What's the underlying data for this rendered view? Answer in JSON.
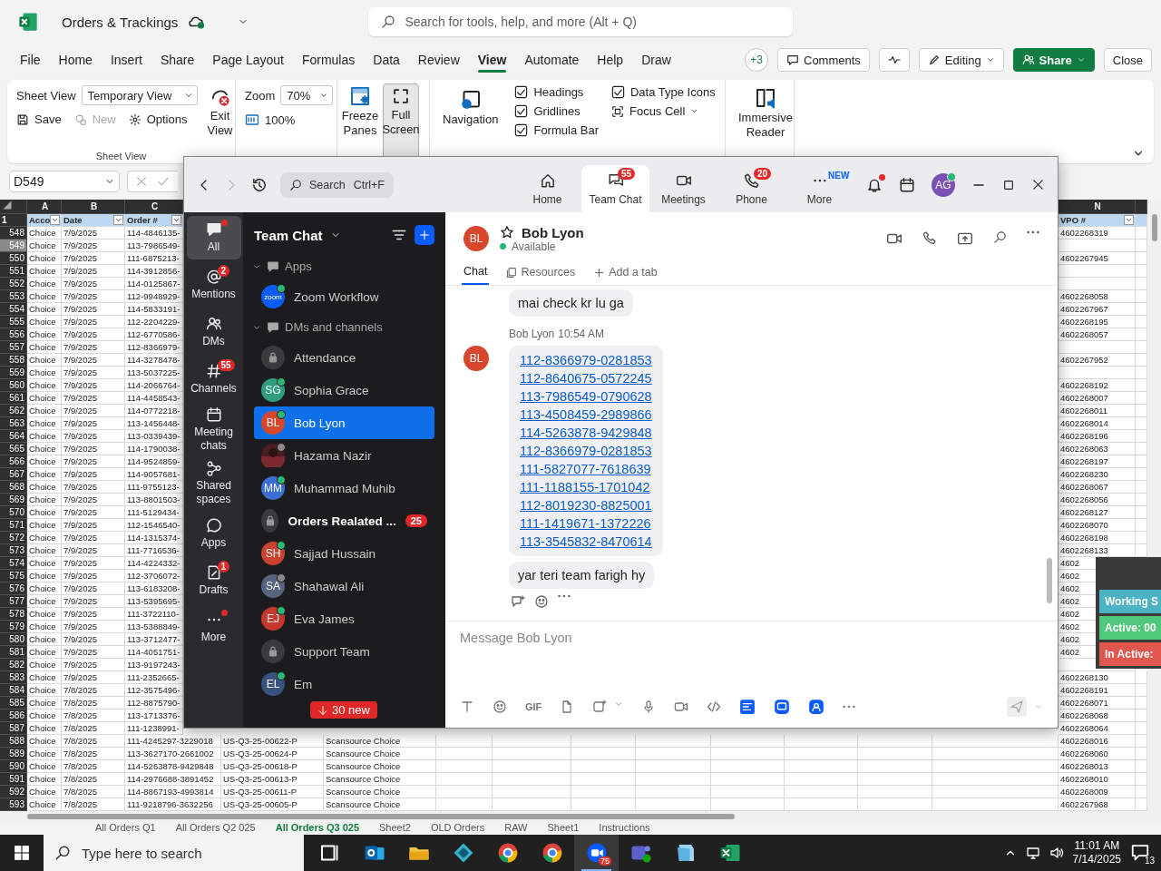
{
  "excel": {
    "title": "Orders & Trackings",
    "search_placeholder": "Search for tools, help, and more (Alt + Q)",
    "menu": [
      {
        "label": "File",
        "selected": false
      },
      {
        "label": "Home",
        "selected": false
      },
      {
        "label": "Insert",
        "selected": false
      },
      {
        "label": "Share",
        "selected": false
      },
      {
        "label": "Page Layout",
        "selected": false
      },
      {
        "label": "Formulas",
        "selected": false
      },
      {
        "label": "Data",
        "selected": false
      },
      {
        "label": "Review",
        "selected": false
      },
      {
        "label": "View",
        "selected": true
      },
      {
        "label": "Automate",
        "selected": false
      },
      {
        "label": "Help",
        "selected": false
      },
      {
        "label": "Draw",
        "selected": false
      }
    ],
    "more_count": "+3",
    "actions": [
      {
        "kind": "comments",
        "label": "Comments"
      },
      {
        "kind": "activity"
      },
      {
        "kind": "editing",
        "label": "Editing"
      },
      {
        "kind": "share",
        "label": "Share"
      },
      {
        "kind": "close",
        "label": "Close"
      }
    ],
    "ribbon": {
      "sheet_view": {
        "label": "Sheet View",
        "value": "Temporary View",
        "exit": "Exit View",
        "save": "Save",
        "new": {
          "label": "New",
          "disabled": true
        },
        "options": "Options",
        "group": "Sheet View"
      },
      "zoom": {
        "label": "Zoom",
        "value": "70%",
        "reset": "100%"
      },
      "window": {
        "freeze": "Freeze Panes",
        "full": {
          "label": "Full Screen",
          "selected": true
        }
      },
      "show": {
        "navigation": "Navigation",
        "checks": [
          {
            "label": "Headings",
            "checked": true
          },
          {
            "label": "Gridlines",
            "checked": true
          },
          {
            "label": "Formula Bar",
            "checked": true
          },
          {
            "label": "Data Type Icons",
            "checked": true
          }
        ],
        "focus": "Focus Cell"
      },
      "views": {
        "reader": "Immersive Reader"
      }
    },
    "name_box": "D549",
    "columns": [
      {
        "letter": "A",
        "heading": "Acco"
      },
      {
        "letter": "B",
        "heading": "Date"
      },
      {
        "letter": "C",
        "heading": "Order #"
      },
      {
        "letter": "N",
        "heading": "VPO #"
      }
    ],
    "header_row": "1",
    "rows": [
      {
        "number": "548",
        "selected": false,
        "account": "Choice",
        "date": "7/9/2025",
        "order": "114-4846135-",
        "vpo": "4602268319"
      },
      {
        "number": "549",
        "selected": true,
        "account": "Choice",
        "date": "7/9/2025",
        "order": "113-7986549-"
      },
      {
        "number": "550",
        "selected": false,
        "account": "Choice",
        "date": "7/9/2025",
        "order": "111-6875213-",
        "vpo": "4602267945"
      },
      {
        "number": "551",
        "selected": false,
        "account": "Choice",
        "date": "7/9/2025",
        "order": "114-3912856-"
      },
      {
        "number": "552",
        "selected": false,
        "account": "Choice",
        "date": "7/9/2025",
        "order": "114-0125867-"
      },
      {
        "number": "553",
        "selected": false,
        "account": "Choice",
        "date": "7/9/2025",
        "order": "112-9948929-",
        "vpo": "4602268058"
      },
      {
        "number": "554",
        "selected": false,
        "account": "Choice",
        "date": "7/9/2025",
        "order": "114-5833191-",
        "vpo": "4602267967"
      },
      {
        "number": "555",
        "selected": false,
        "account": "Choice",
        "date": "7/9/2025",
        "order": "112-2204229-",
        "vpo": "4602268195"
      },
      {
        "number": "556",
        "selected": false,
        "account": "Choice",
        "date": "7/9/2025",
        "order": "112-6770586-",
        "vpo": "4602268057"
      },
      {
        "number": "557",
        "selected": false,
        "account": "Choice",
        "date": "7/9/2025",
        "order": "112-8366979-"
      },
      {
        "number": "558",
        "selected": false,
        "account": "Choice",
        "date": "7/9/2025",
        "order": "114-3278478-",
        "vpo": "4602267952"
      },
      {
        "number": "559",
        "selected": false,
        "account": "Choice",
        "date": "7/9/2025",
        "order": "113-5037225-"
      },
      {
        "number": "560",
        "selected": false,
        "account": "Choice",
        "date": "7/9/2025",
        "order": "114-2066764-",
        "vpo": "4602268192"
      },
      {
        "number": "561",
        "selected": false,
        "account": "Choice",
        "date": "7/9/2025",
        "order": "114-4458543-",
        "vpo": "4602268007"
      },
      {
        "number": "562",
        "selected": false,
        "account": "Choice",
        "date": "7/9/2025",
        "order": "114-0772218-",
        "vpo": "4602268011"
      },
      {
        "number": "563",
        "selected": false,
        "account": "Choice",
        "date": "7/9/2025",
        "order": "113-1456448-",
        "vpo": "4602268014"
      },
      {
        "number": "564",
        "selected": false,
        "account": "Choice",
        "date": "7/9/2025",
        "order": "113-0339439-",
        "vpo": "4602268196"
      },
      {
        "number": "565",
        "selected": false,
        "account": "Choice",
        "date": "7/9/2025",
        "order": "114-1790038-",
        "vpo": "4602268063"
      },
      {
        "number": "566",
        "selected": false,
        "account": "Choice",
        "date": "7/9/2025",
        "order": "114-9524859-",
        "vpo": "4602268197"
      },
      {
        "number": "567",
        "selected": false,
        "account": "Choice",
        "date": "7/9/2025",
        "order": "114-9057681-",
        "vpo": "4602268230"
      },
      {
        "number": "568",
        "selected": false,
        "account": "Choice",
        "date": "7/9/2025",
        "order": "111-9755123-",
        "vpo": "4602268067"
      },
      {
        "number": "569",
        "selected": false,
        "account": "Choice",
        "date": "7/9/2025",
        "order": "113-8801503-",
        "vpo": "4602268056"
      },
      {
        "number": "570",
        "selected": false,
        "account": "Choice",
        "date": "7/9/2025",
        "order": "111-5129434-",
        "vpo": "4602268127"
      },
      {
        "number": "571",
        "selected": false,
        "account": "Choice",
        "date": "7/9/2025",
        "order": "112-1546540-",
        "vpo": "4602268070"
      },
      {
        "number": "572",
        "selected": false,
        "account": "Choice",
        "date": "7/9/2025",
        "order": "114-1315374-",
        "vpo": "4602268198"
      },
      {
        "number": "573",
        "selected": false,
        "account": "Choice",
        "date": "7/9/2025",
        "order": "111-7716536-",
        "vpo": "4602268133"
      },
      {
        "number": "574",
        "selected": false,
        "account": "Choice",
        "date": "7/9/2025",
        "order": "114-4224332-",
        "vpo": "4602"
      },
      {
        "number": "575",
        "selected": false,
        "account": "Choice",
        "date": "7/9/2025",
        "order": "112-3706072-",
        "vpo": "4602"
      },
      {
        "number": "576",
        "selected": false,
        "account": "Choice",
        "date": "7/9/2025",
        "order": "113-6183208-",
        "vpo": "4602"
      },
      {
        "number": "577",
        "selected": false,
        "account": "Choice",
        "date": "7/9/2025",
        "order": "113-5395695-",
        "vpo": "4602"
      },
      {
        "number": "578",
        "selected": false,
        "account": "Choice",
        "date": "7/9/2025",
        "order": "111-3722110-",
        "vpo": "4602"
      },
      {
        "number": "579",
        "selected": false,
        "account": "Choice",
        "date": "7/9/2025",
        "order": "113-5388849-",
        "vpo": "4602"
      },
      {
        "number": "580",
        "selected": false,
        "account": "Choice",
        "date": "7/9/2025",
        "order": "113-3712477-",
        "vpo": "4602"
      },
      {
        "number": "581",
        "selected": false,
        "account": "Choice",
        "date": "7/9/2025",
        "order": "114-4051751-",
        "vpo": "4602"
      },
      {
        "number": "582",
        "selected": false,
        "account": "Choice",
        "date": "7/9/2025",
        "order": "113-9197243-"
      },
      {
        "number": "583",
        "selected": false,
        "account": "Choice",
        "date": "7/9/2025",
        "order": "111-2352665-",
        "vpo": "4602268130"
      },
      {
        "number": "584",
        "selected": false,
        "account": "Choice",
        "date": "7/8/2025",
        "order": "112-3575496-",
        "vpo": "4602268191"
      },
      {
        "number": "585",
        "selected": false,
        "account": "Choice",
        "date": "7/8/2025",
        "order": "112-8875790-",
        "vpo": "4602268071"
      },
      {
        "number": "586",
        "selected": false,
        "account": "Choice",
        "date": "7/8/2025",
        "order": "113-1713376-",
        "vpo": "4602268068"
      },
      {
        "number": "587",
        "selected": false,
        "account": "Choice",
        "date": "7/8/2025",
        "order": "111-1238991-",
        "vpo": "4602268064"
      },
      {
        "number": "588",
        "selected": false,
        "account": "Choice",
        "date": "7/8/2025",
        "order": "111-4245297-3229018",
        "po": "US-Q3-25-00622-P",
        "vendor": "Scansource Choice",
        "vpo": "4602268016"
      },
      {
        "number": "589",
        "selected": false,
        "account": "Choice",
        "date": "7/8/2025",
        "order": "113-3627170-2661002",
        "po": "US-Q3-25-00624-P",
        "vendor": "Scansource Choice",
        "vpo": "4602268060"
      },
      {
        "number": "590",
        "selected": false,
        "account": "Choice",
        "date": "7/8/2025",
        "order": "114-5263878-9429848",
        "po": "US-Q3-25-00618-P",
        "vendor": "Scansource Choice",
        "vpo": "4602268013"
      },
      {
        "number": "591",
        "selected": false,
        "account": "Choice",
        "date": "7/8/2025",
        "order": "114-2976688-3891452",
        "po": "US-Q3-25-00613-P",
        "vendor": "Scansource Choice",
        "vpo": "4602268010"
      },
      {
        "number": "592",
        "selected": false,
        "account": "Choice",
        "date": "7/8/2025",
        "order": "114-8867193-4993814",
        "po": "US-Q3-25-00611-P",
        "vendor": "Scansource Choice",
        "vpo": "4602268009"
      },
      {
        "number": "593",
        "selected": false,
        "account": "Choice",
        "date": "7/8/2025",
        "order": "111-9218796-3632256",
        "po": "US-Q3-25-00605-P",
        "vendor": "Scansource Choice",
        "vpo": "4602267968"
      }
    ],
    "sheet_tabs": [
      {
        "label": "All Orders Q1",
        "selected": false
      },
      {
        "label": "All Orders Q2 025",
        "selected": false
      },
      {
        "label": "All Orders Q3 025",
        "selected": true
      },
      {
        "label": "Sheet2",
        "selected": false
      },
      {
        "label": "OLD Orders",
        "selected": false
      },
      {
        "label": "RAW",
        "selected": false
      },
      {
        "label": "Sheet1",
        "selected": false
      },
      {
        "label": "Instructions",
        "selected": false
      }
    ]
  },
  "zoom": {
    "nav": {
      "forward_disabled": true
    },
    "search": {
      "placeholder": "Search",
      "shortcut": "Ctrl+F"
    },
    "tabs": [
      {
        "kind": "home",
        "label": "Home",
        "selected": false
      },
      {
        "kind": "chat",
        "label": "Team Chat",
        "selected": true,
        "badge": "55"
      },
      {
        "kind": "meetings",
        "label": "Meetings",
        "selected": false
      },
      {
        "kind": "phone",
        "label": "Phone",
        "selected": false,
        "badge": "20"
      },
      {
        "kind": "more",
        "label": "More",
        "selected": false,
        "tag": "NEW"
      }
    ],
    "notification_dot": true,
    "avatar": "AG",
    "rail": [
      {
        "kind": "all",
        "label": "All",
        "selected": true,
        "dot": true
      },
      {
        "kind": "mentions",
        "label": "Mentions",
        "selected": false,
        "badge": "2",
        "dot": false
      },
      {
        "kind": "dms",
        "label": "DMs",
        "selected": false,
        "dot": false
      },
      {
        "kind": "channels",
        "label": "Channels",
        "selected": false,
        "badge": "55",
        "dot": false
      },
      {
        "kind": "meeting",
        "label": "Meeting chats",
        "selected": false,
        "dot": false
      },
      {
        "kind": "shared",
        "label": "Shared spaces",
        "selected": false,
        "dot": false
      },
      {
        "kind": "apps",
        "label": "Apps",
        "selected": false,
        "dot": false
      },
      {
        "kind": "drafts",
        "label": "Drafts",
        "selected": false,
        "badge": "1",
        "dot": false
      },
      {
        "kind": "more",
        "label": "More",
        "selected": false,
        "dot": true
      }
    ],
    "list_title": "Team Chat",
    "sections": [
      {
        "label": "Apps",
        "expanded": true,
        "items": [
          {
            "kind": "app",
            "name": "Zoom Workflow",
            "initials": "zoom",
            "color": "#0b5cff",
            "away": false,
            "selected": false
          }
        ]
      },
      {
        "label": "DMs and channels",
        "expanded": true,
        "items": [
          {
            "kind": "channel",
            "name": "Attendance",
            "selected": false
          },
          {
            "kind": "person",
            "name": "Sophia Grace",
            "initials": "SG",
            "color": "#2f9e7c",
            "away": false,
            "selected": false
          },
          {
            "kind": "person",
            "name": "Bob Lyon",
            "initials": "BL",
            "color": "#d8472b",
            "away": false,
            "selected": true
          },
          {
            "name": "Hazama Nazir",
            "away": true,
            "selected": false
          },
          {
            "kind": "person",
            "name": "Muhammad Muhib",
            "initials": "MM",
            "color": "#3b6fd1",
            "away": false,
            "selected": false
          },
          {
            "kind": "channel",
            "name": "Orders Realated ...",
            "badge": "25",
            "selected": false
          },
          {
            "kind": "person",
            "name": "Sajjad Hussain",
            "initials": "SH",
            "color": "#c9432f",
            "away": false,
            "selected": false
          },
          {
            "kind": "person",
            "name": "Shahawal Ali",
            "initials": "SA",
            "color": "#56647e",
            "away": true,
            "selected": false
          },
          {
            "kind": "person",
            "name": "Eva James",
            "initials": "EJ",
            "color": "#c8372d",
            "away": false,
            "selected": false
          },
          {
            "kind": "channel",
            "name": "Support Team",
            "selected": false
          },
          {
            "kind": "person",
            "name": "Em",
            "initials": "EL",
            "color": "#3a5280",
            "away": false,
            "selected": false
          }
        ]
      }
    ],
    "new_pill": "30 new",
    "chat": {
      "contact": {
        "name": "Bob Lyon",
        "initials": "BL",
        "color": "#d8472b",
        "status": "Available"
      },
      "tabs": [
        {
          "kind": "chat",
          "label": "Chat",
          "selected": true
        },
        {
          "kind": "resources",
          "label": "Resources",
          "selected": false
        },
        {
          "kind": "add",
          "label": "Add a tab",
          "selected": false
        }
      ],
      "messages": [
        {
          "text": "mai check kr lu ga"
        },
        {
          "sender": "Bob Lyon",
          "time": "10:54 AM",
          "initials": "BL",
          "links": [
            "112-8366979-0281853",
            "112-8640675-0572245",
            "113-7986549-0790628",
            "113-4508459-2989866",
            "114-5263878-9429848",
            "112-8366979-0281853",
            "111-5827077-7618639",
            "111-1188155-1701042",
            "112-8019230-8825001",
            "111-1419671-1372226",
            "113-3545832-8470614"
          ]
        },
        {
          "text": "yar teri team farigh hy"
        }
      ],
      "composer": {
        "placeholder": "Message Bob Lyon",
        "gif": "GIF"
      }
    }
  },
  "widget": [
    {
      "kind": "working",
      "label": "Working S"
    },
    {
      "kind": "active",
      "label": "Active: 00"
    },
    {
      "kind": "inactive",
      "label": "In Active:"
    }
  ],
  "taskbar": {
    "search_placeholder": "Type here to search",
    "apps": [
      {
        "kind": "taskview",
        "active": false
      },
      {
        "kind": "mail",
        "active": false
      },
      {
        "kind": "folder",
        "active": false
      },
      {
        "kind": "diamond",
        "active": false
      },
      {
        "kind": "browser",
        "active": false
      },
      {
        "kind": "browser",
        "active": false
      },
      {
        "kind": "video",
        "active": true,
        "badge": "75"
      },
      {
        "kind": "teams",
        "active": false
      },
      {
        "kind": "notes",
        "active": false
      },
      {
        "kind": "sheet",
        "active": false
      }
    ],
    "time": "11:01 AM",
    "date": "7/14/2025",
    "notifications": "13"
  }
}
